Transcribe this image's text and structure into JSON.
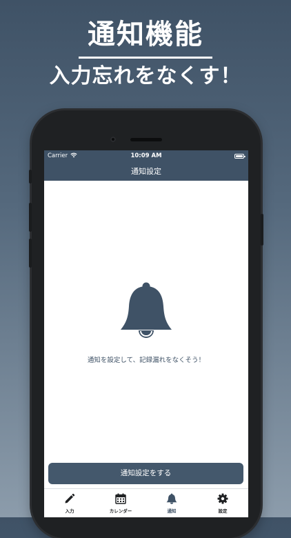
{
  "promo": {
    "headline": "通知機能",
    "subheadline": "入力忘れをなくす！"
  },
  "status_bar": {
    "carrier": "Carrier",
    "time": "10:09 AM"
  },
  "nav": {
    "title": "通知設定"
  },
  "content": {
    "icon": "bell-icon",
    "message": "通知を設定して、記録漏れをなくそう！",
    "action_button": "通知設定をする"
  },
  "tabs": [
    {
      "label": "入力",
      "icon": "pencil-icon",
      "active": false
    },
    {
      "label": "カレンダー",
      "icon": "calendar-icon",
      "active": false
    },
    {
      "label": "通知",
      "icon": "bell-icon",
      "active": true
    },
    {
      "label": "設定",
      "icon": "gear-icon",
      "active": false
    }
  ],
  "colors": {
    "accent": "#3f5266",
    "background_top": "#3f5266",
    "background_bottom": "#8c9cab",
    "phone_frame": "#1f2123",
    "screen_background": "#ffffff"
  }
}
